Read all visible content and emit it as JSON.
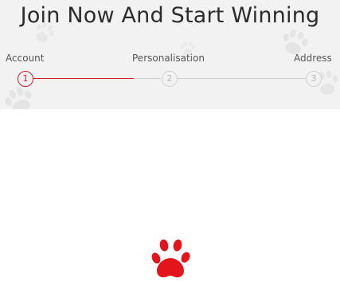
{
  "page": {
    "title": "Join Now And Start Winning"
  },
  "steps": [
    {
      "number": "1",
      "label": "Account",
      "state": "active"
    },
    {
      "number": "2",
      "label": "Personalisation",
      "state": "inactive"
    },
    {
      "number": "3",
      "label": "Address",
      "state": "inactive"
    }
  ],
  "loader": {
    "icon": "paw-icon",
    "color": "#e3141c"
  },
  "colors": {
    "accent": "#d0202e",
    "header_bg": "#f2f2f2",
    "inactive": "#cfcfcf"
  }
}
